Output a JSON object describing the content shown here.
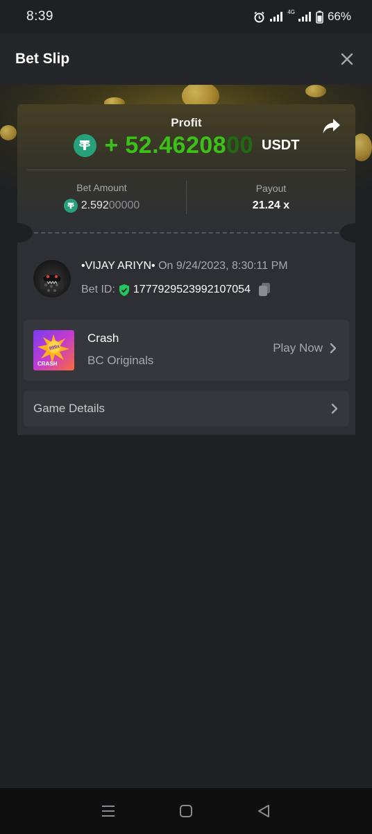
{
  "status_bar": {
    "time": "8:39",
    "network_badge": "4G",
    "battery": "66%"
  },
  "header": {
    "title": "Bet Slip",
    "close_icon": "close-icon"
  },
  "slip": {
    "profit_label": "Profit",
    "profit_sign": "+",
    "profit_main": "52.46208",
    "profit_trailing": "00",
    "currency": "USDT",
    "bet_amount_label": "Bet Amount",
    "bet_amount_main": "2.592",
    "bet_amount_trailing": "00000",
    "payout_label": "Payout",
    "payout_value": "21.24 x"
  },
  "user": {
    "name": "•VIJAY ARIYN•",
    "date_text": "On 9/24/2023, 8:30:11 PM",
    "bet_id_label": "Bet ID:",
    "bet_id": "1777929523992107054"
  },
  "game": {
    "name": "Crash",
    "provider": "BC Originals",
    "thumb_badge": "999x",
    "thumb_label": "CRASH",
    "play_label": "Play Now"
  },
  "details": {
    "label": "Game Details"
  },
  "colors": {
    "profit_green": "#3bc117",
    "usdt_teal": "#26a17b",
    "verified_green": "#22c55e",
    "background": "#1f2023",
    "card": "#2d2f34"
  },
  "icons": [
    "alarm-icon",
    "signal-icon",
    "battery-icon",
    "close-icon",
    "share-icon",
    "usdt-icon",
    "shield-check-icon",
    "copy-icon",
    "chevron-right-icon",
    "menu-icon",
    "home-icon",
    "back-icon"
  ]
}
